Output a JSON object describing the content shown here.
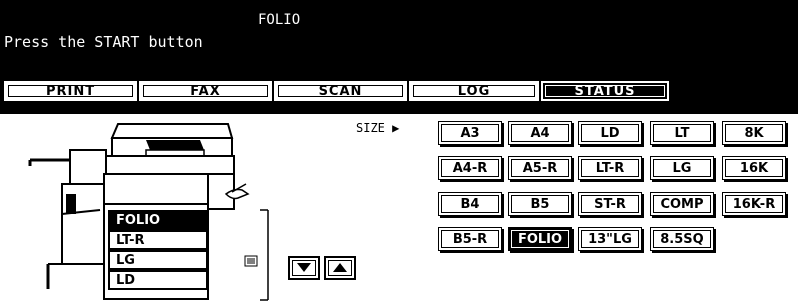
{
  "message": {
    "title": "FOLIO",
    "line": "Press the START button"
  },
  "tabs": [
    {
      "label": "PRINT",
      "active": false
    },
    {
      "label": "FAX",
      "active": false
    },
    {
      "label": "SCAN",
      "active": false
    },
    {
      "label": "LOG",
      "active": false
    },
    {
      "label": "STATUS",
      "active": true
    }
  ],
  "trays": [
    {
      "label": "FOLIO",
      "selected": true
    },
    {
      "label": "LT-R",
      "selected": false
    },
    {
      "label": "LG",
      "selected": false
    },
    {
      "label": "LD",
      "selected": false
    }
  ],
  "size_label": "SIZE",
  "size_label_icon": "triangle-right-icon",
  "sizes": [
    {
      "label": "A3",
      "selected": false
    },
    {
      "label": "A4",
      "selected": false
    },
    {
      "label": "LD",
      "selected": false
    },
    {
      "label": "LT",
      "selected": false
    },
    {
      "label": "8K",
      "selected": false
    },
    {
      "label": "A4-R",
      "selected": false
    },
    {
      "label": "A5-R",
      "selected": false
    },
    {
      "label": "LT-R",
      "selected": false
    },
    {
      "label": "LG",
      "selected": false
    },
    {
      "label": "16K",
      "selected": false
    },
    {
      "label": "B4",
      "selected": false
    },
    {
      "label": "B5",
      "selected": false
    },
    {
      "label": "ST-R",
      "selected": false
    },
    {
      "label": "COMP",
      "selected": false
    },
    {
      "label": "16K-R",
      "selected": false
    },
    {
      "label": "B5-R",
      "selected": false
    },
    {
      "label": "FOLIO",
      "selected": true
    },
    {
      "label": "13\"LG",
      "selected": false
    },
    {
      "label": "8.5SQ",
      "selected": false
    }
  ],
  "scroll": {
    "up_icon": "triangle-up-icon",
    "down_icon": "triangle-down-icon"
  }
}
